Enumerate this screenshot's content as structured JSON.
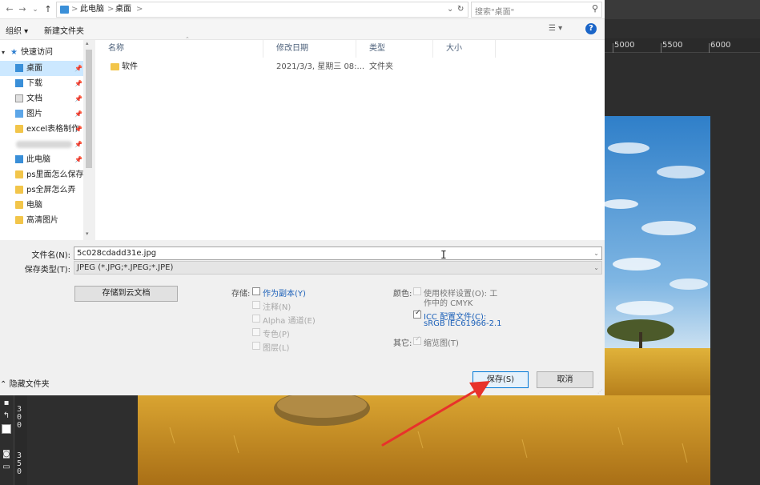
{
  "address_bar": {
    "back": "←",
    "forward": "→",
    "dropdown": "⌄",
    "up": "↑",
    "crumbs": [
      "此电脑",
      "桌面"
    ],
    "separator": ">",
    "refresh": "↻",
    "search_placeholder": "搜索\"桌面\""
  },
  "toolbar": {
    "organize": "组织",
    "new_folder": "新建文件夹",
    "help": "?"
  },
  "nav": {
    "quick_access": "快速访问",
    "items": [
      {
        "label": "桌面",
        "icon": "desktop-folder-icon",
        "pinned": true,
        "selected": true
      },
      {
        "label": "下载",
        "icon": "download-folder-icon",
        "pinned": true
      },
      {
        "label": "文档",
        "icon": "documents-folder-icon",
        "pinned": true
      },
      {
        "label": "图片",
        "icon": "pictures-folder-icon",
        "pinned": true
      },
      {
        "label": "excel表格制作",
        "icon": "folder-icon",
        "pinned": true
      },
      {
        "label": "",
        "icon": "blurred-item",
        "pinned": true
      },
      {
        "label": "此电脑",
        "icon": "this-pc-icon",
        "pinned": true
      },
      {
        "label": "ps里面怎么保存",
        "icon": "folder-icon"
      },
      {
        "label": "ps全屏怎么弄",
        "icon": "folder-icon"
      },
      {
        "label": "电脑",
        "icon": "folder-icon"
      },
      {
        "label": "高清图片",
        "icon": "folder-icon"
      }
    ],
    "pin_glyph": "📌"
  },
  "file_list": {
    "columns": [
      "名称",
      "修改日期",
      "类型",
      "大小"
    ],
    "rows": [
      {
        "name": "软件",
        "date": "2021/3/3, 星期三 08:...",
        "type": "文件夹",
        "size": ""
      }
    ]
  },
  "filename": {
    "label": "文件名(N):",
    "value": "5c028cdadd31e.jpg"
  },
  "filetype": {
    "label": "保存类型(T):",
    "value": "JPEG (*.JPG;*.JPEG;*.JPE)"
  },
  "options": {
    "cloud_button": "存储到云文档",
    "save_label": "存储:",
    "as_copy": "作为副本(Y)",
    "notes": "注释(N)",
    "alpha": "Alpha 通道(E)",
    "spot": "专色(P)",
    "layers": "图层(L)",
    "color_label": "颜色:",
    "proof": "使用校样设置(O): 工",
    "proof_line2": "作中的 CMYK",
    "icc": "ICC 配置文件(C):",
    "icc_line2": "sRGB IEC61966-2.1",
    "other_label": "其它:",
    "thumbnail": "缩览图(T)",
    "check_mark": "✓"
  },
  "footer": {
    "hide_folders": "隐藏文件夹",
    "save": "保存(S)",
    "cancel": "取消"
  },
  "photoshop": {
    "ruler_labels": [
      "5000",
      "5500",
      "6000"
    ],
    "left_ruler_digits": [
      "3",
      "0",
      "0",
      "3",
      "5",
      "0"
    ]
  },
  "colors": {
    "selection": "#cce8ff",
    "accent": "#0078d7",
    "link_blue": "#1a5fb8",
    "arrow": "#e8322b"
  }
}
